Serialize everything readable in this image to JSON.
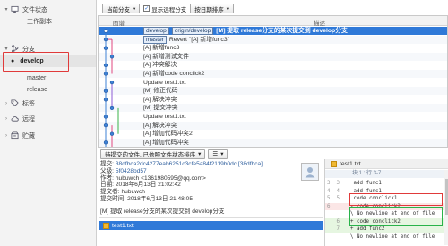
{
  "sidebar": {
    "file_status": "文件状态",
    "working_copy": "工作副本",
    "branches": "分支",
    "develop": "develop",
    "master": "master",
    "release": "release",
    "tags": "标签",
    "remotes": "远程",
    "stashes": "贮藏"
  },
  "toolbar": {
    "branch_filter": "当前分支",
    "show_remote": "显示远程分支",
    "sort_order": "按日期排序"
  },
  "commit_list": {
    "col_graph": "图谱",
    "col_desc": "描述",
    "rows": [
      {
        "tags": [
          "develop",
          "origin/develop"
        ],
        "msg": "[M] 提取 release分支的某次提交到 develop分支"
      },
      {
        "tags": [
          "master"
        ],
        "msg": "Revert \"[A] 新增func3\""
      },
      {
        "tags": [],
        "msg": "[A] 新增func3"
      },
      {
        "tags": [],
        "msg": "[A] 新增测试文件"
      },
      {
        "tags": [],
        "msg": "[A] 冲突解决"
      },
      {
        "tags": [],
        "msg": "[A] 新增code conclick2"
      },
      {
        "tags": [],
        "msg": "Update test1.txt"
      },
      {
        "tags": [],
        "msg": " [M] 修正代码"
      },
      {
        "tags": [],
        "msg": "[A] 解决冲突"
      },
      {
        "tags": [],
        "msg": "[M] 提交冲突"
      },
      {
        "tags": [],
        "msg": "Update test1.txt"
      },
      {
        "tags": [],
        "msg": "[A] 解决冲突"
      },
      {
        "tags": [],
        "msg": "[A] 增加代码冲突2"
      },
      {
        "tags": [],
        "msg": "[A] 增加代码冲突"
      }
    ]
  },
  "lower": {
    "filter_label": "待提交的文件, 已依照文件状态排序",
    "commit_label": "提交:",
    "commit_hash": "38dfbca2dc4277eab6251c3cfe5a84f2119b0dc [38dfbca]",
    "parent_label": "父级:",
    "parent_hash": "5f0428bd57",
    "author_label": "作者:",
    "author": "hubuwch <1361980595@qq.com>",
    "date_label": "日期:",
    "date": "2018年6月13日 21:02:42",
    "committer_label": "提交者:",
    "committer": "hubuwch",
    "commit_time_label": "提交时间:",
    "commit_time": "2018年6月13日 21:48:05",
    "message": "[M] 提取 release分支的某次提交到 develop分支",
    "file": "test1.txt"
  },
  "diff": {
    "file": "test1.txt",
    "hunk": "块 1 : 行 3-7",
    "lines": [
      {
        "ln": "3  3",
        "text": " add func1",
        "kind": "ctx"
      },
      {
        "ln": "4  4",
        "text": " add func1",
        "kind": "ctx"
      },
      {
        "ln": "5  5",
        "text": " code conclick1",
        "kind": "ctx"
      },
      {
        "ln": "6",
        "text": "- code conclick2",
        "kind": "del"
      },
      {
        "ln": "",
        "text": "\\ No newline at end of file",
        "kind": "ctx"
      },
      {
        "ln": "   6",
        "text": "+ code conclick2",
        "kind": "add"
      },
      {
        "ln": "   7",
        "text": "+ add func2",
        "kind": "add"
      },
      {
        "ln": "",
        "text": "\\ No newline at end of file",
        "kind": "ctx"
      }
    ]
  },
  "colors": {
    "selection": "#2f79d8",
    "highlight_red": "#e03a3a",
    "highlight_green": "#29b34a"
  }
}
